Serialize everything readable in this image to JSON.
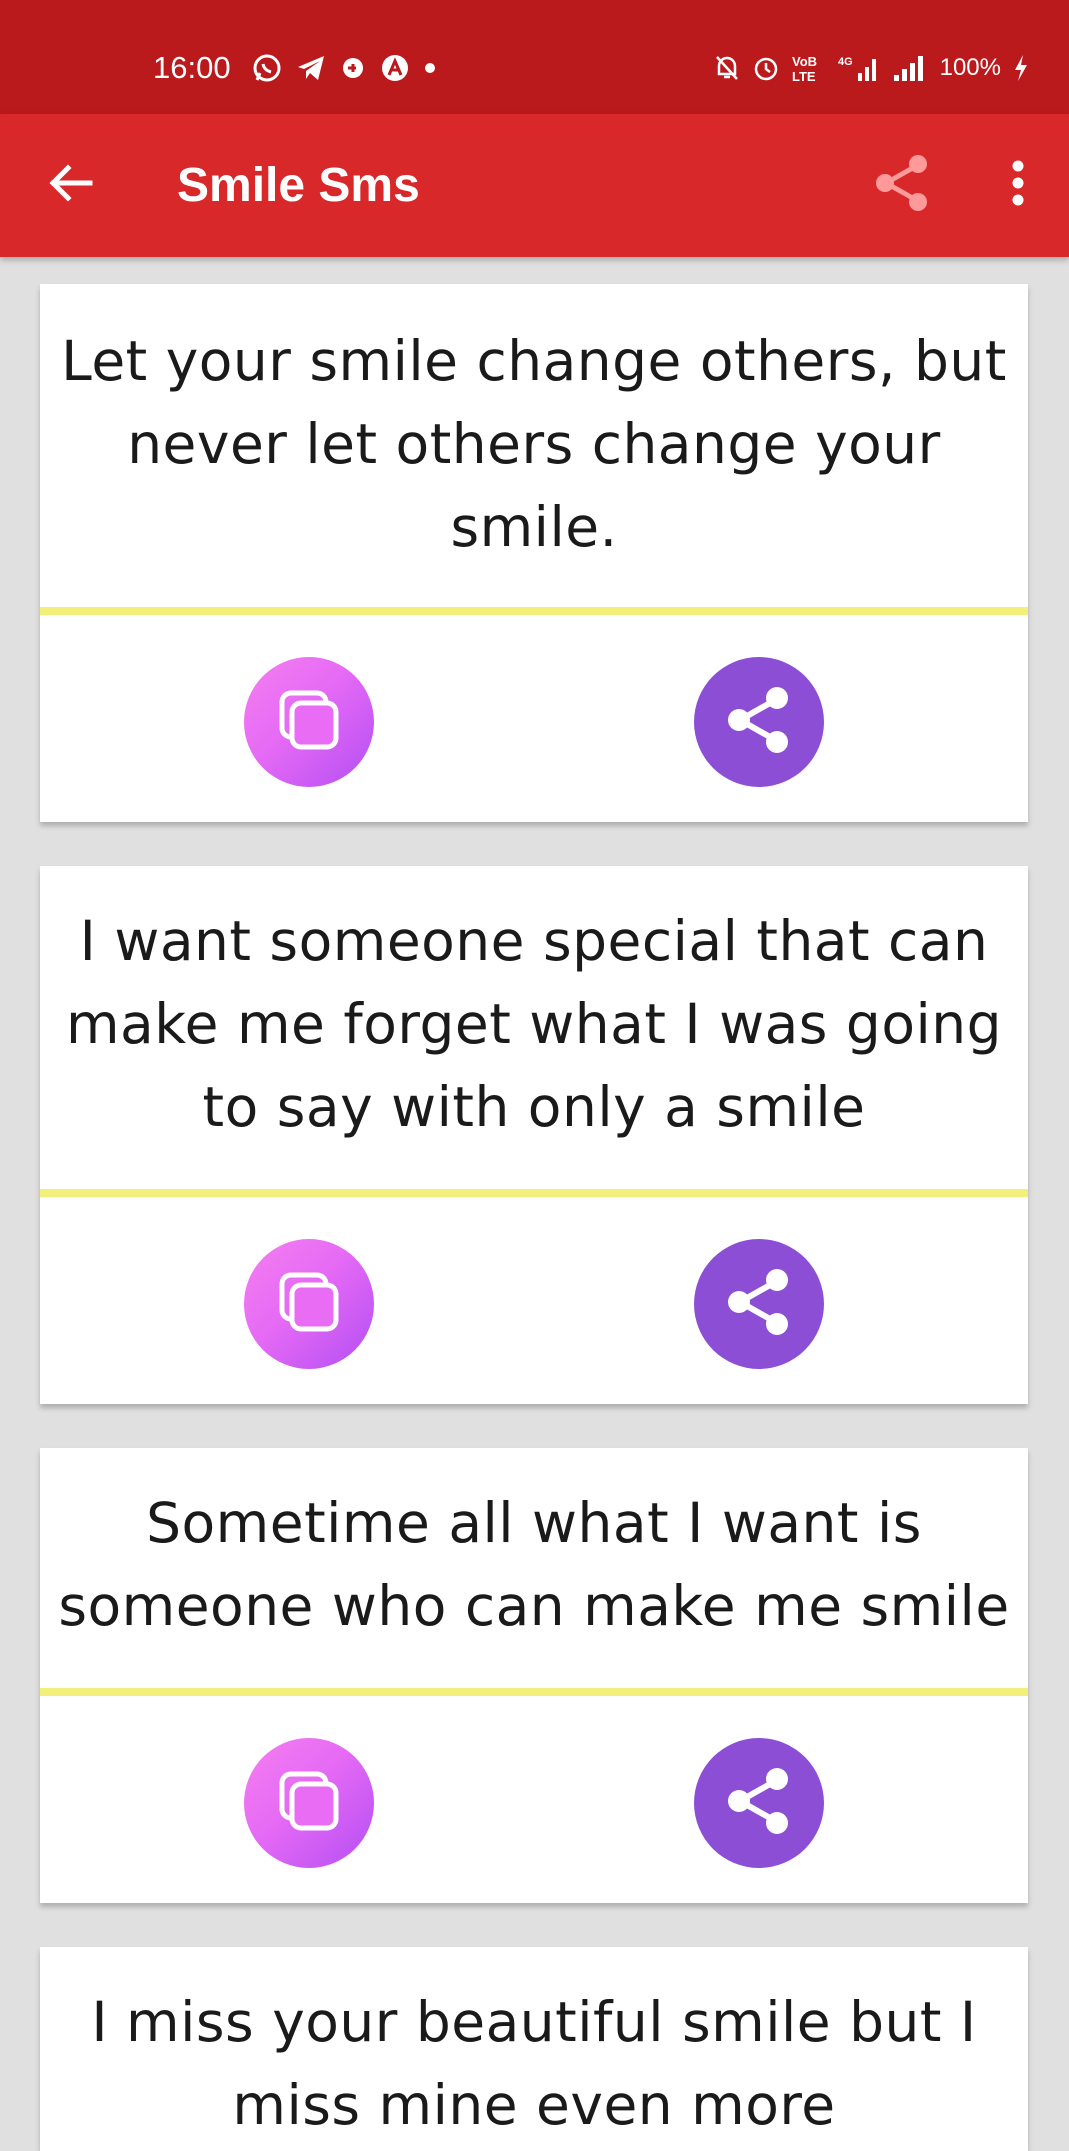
{
  "status_bar": {
    "time": "16:00",
    "battery": "100%",
    "left_icons": [
      "whatsapp-icon",
      "telegram-icon",
      "vpn-icon",
      "alert-a-icon",
      "dot-icon"
    ],
    "right_icons": [
      "mute-bell-icon",
      "alarm-icon",
      "volte-icon",
      "signal-4g-icon",
      "signal-icon",
      "charging-icon"
    ]
  },
  "app_bar": {
    "title": "Smile Sms",
    "back_icon": "arrow-left-icon",
    "share_icon": "share-icon",
    "more_icon": "more-vert-icon"
  },
  "colors": {
    "status_bar": "#bb1a1d",
    "app_bar": "#d8282a",
    "divider": "#f2f07a",
    "copy_button": "#e56af5",
    "share_button": "#8d4ed6",
    "background": "#e0e0e0"
  },
  "messages": [
    {
      "text": "Let your smile change others, but never let others change your smile."
    },
    {
      "text": "I want someone special that can make me forget what I was going to say with only a smile"
    },
    {
      "text": "Sometime all what I want is someone who can make me smile"
    },
    {
      "text": "I miss your beautiful smile but I miss mine even more"
    }
  ]
}
